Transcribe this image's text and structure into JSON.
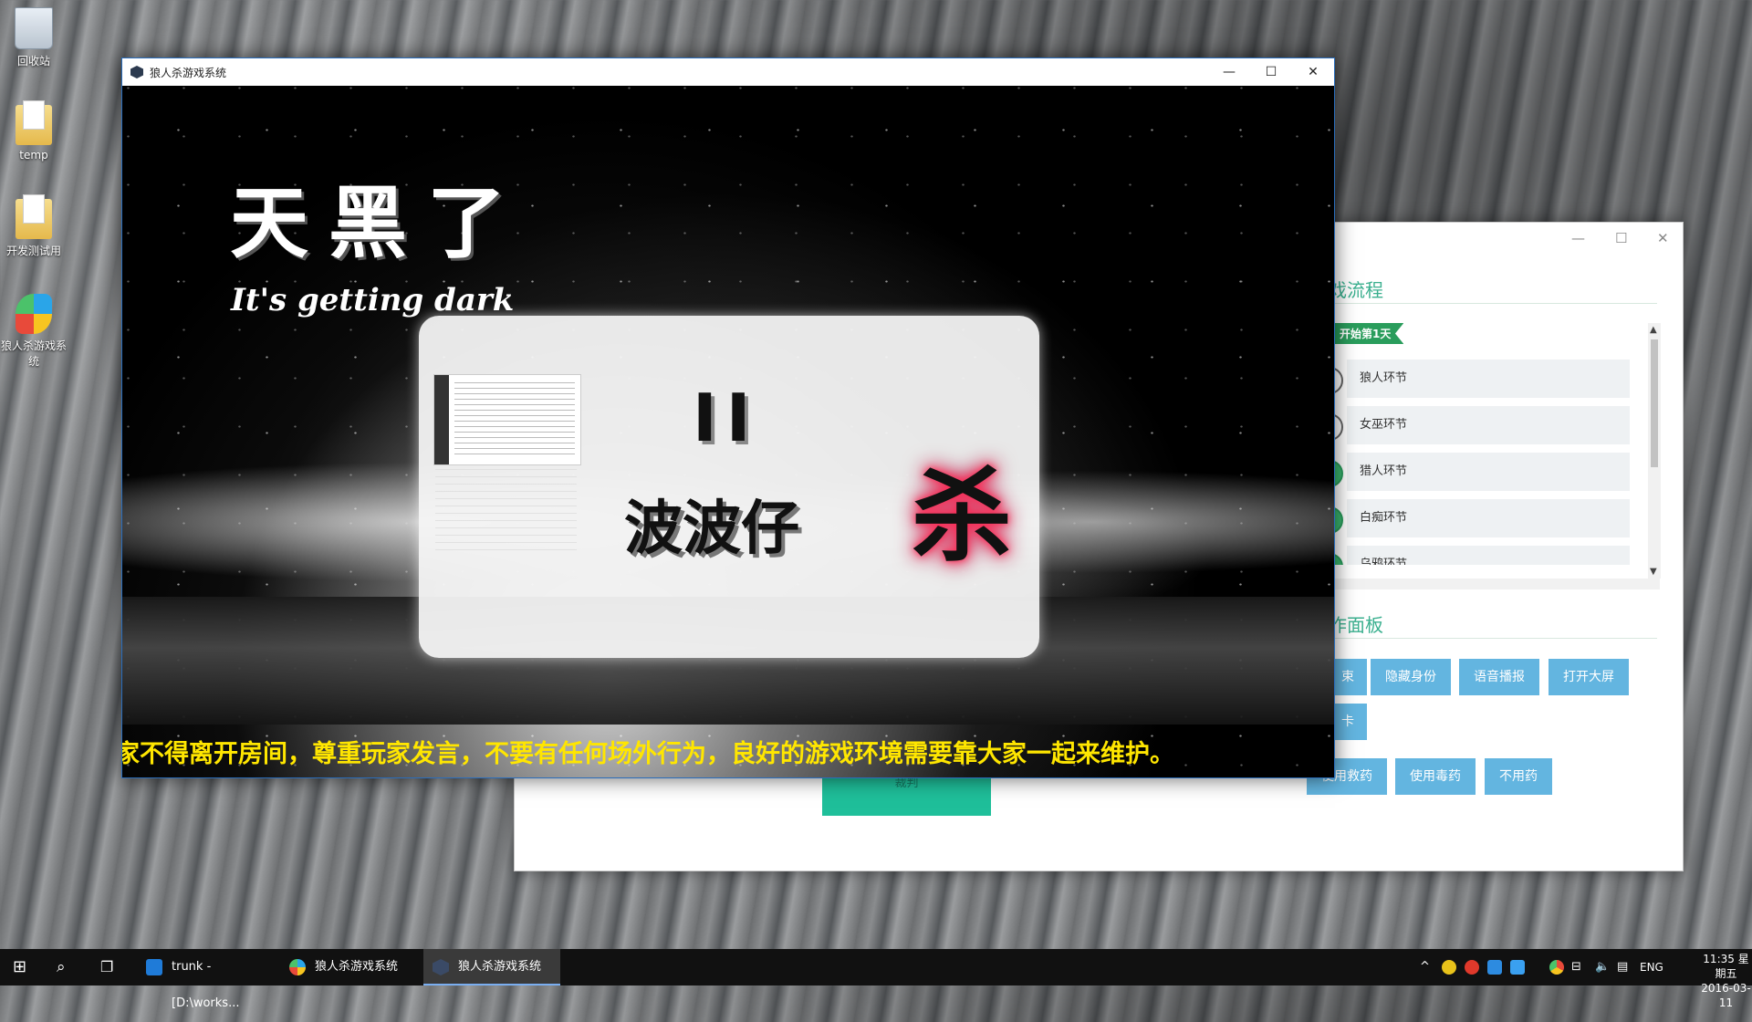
{
  "desktop": {
    "icons": [
      {
        "label": "回收站"
      },
      {
        "label": "temp"
      },
      {
        "label": "开发测试用"
      },
      {
        "label": "狼人杀游戏系统"
      }
    ]
  },
  "back_window": {
    "section1_title": "戏流程",
    "day_flag": "开始第1天",
    "steps": [
      {
        "label": "狼人环节"
      },
      {
        "label": "女巫环节"
      },
      {
        "label": "猎人环节"
      },
      {
        "label": "白痴环节"
      },
      {
        "label": "乌鸦环节"
      }
    ],
    "section2_title": "作面板",
    "buttons_row1": [
      "束",
      "隐藏身份",
      "语音播报",
      "打开大屏"
    ],
    "buttons_row2": [
      "卡"
    ],
    "buttons_row3": [
      "使用救药",
      "使用毒药",
      "不用药"
    ],
    "teal_button": "裁判"
  },
  "front_window": {
    "title": "狼人杀游戏系统",
    "minimize": "—",
    "maximize": "☐",
    "close": "✕",
    "heading": "天黑了",
    "subheading": "It's getting dark",
    "pause_symbol": "II",
    "player_name": "波波仔",
    "kill_mark": "杀",
    "notice": "家不得离开房间，尊重玩家发言，不要有任何场外行为，良好的游戏环境需要靠大家一起来维护。"
  },
  "taskbar": {
    "tasks": [
      {
        "label": "trunk - [D:\\works..."
      },
      {
        "label": "狼人杀游戏系统"
      },
      {
        "label": "狼人杀游戏系统"
      }
    ],
    "lang": "ENG",
    "time": "11:35 星期五",
    "date": "2016-03-11"
  }
}
